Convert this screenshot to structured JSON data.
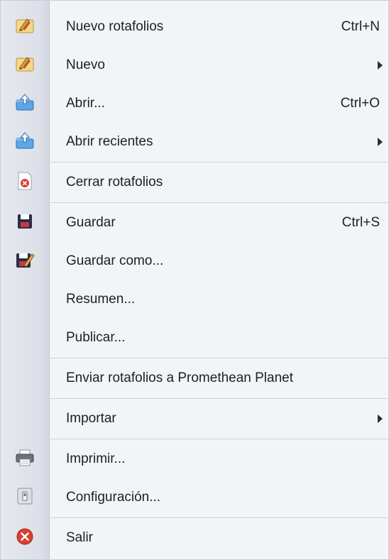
{
  "menu": {
    "items": [
      {
        "label": "Nuevo rotafolios",
        "shortcut": "Ctrl+N",
        "icon": "flipchart-new-icon"
      },
      {
        "label": "Nuevo",
        "submenu": true,
        "icon": "flipchart-new-icon"
      },
      {
        "label": "Abrir...",
        "shortcut": "Ctrl+O",
        "icon": "folder-open-icon"
      },
      {
        "label": "Abrir recientes",
        "submenu": true,
        "icon": "folder-open-icon"
      },
      {
        "label": "Cerrar rotafolios",
        "icon": "close-document-icon"
      },
      {
        "label": "Guardar",
        "shortcut": "Ctrl+S",
        "icon": "save-icon"
      },
      {
        "label": "Guardar como...",
        "icon": "save-as-icon"
      },
      {
        "label": "Resumen...",
        "icon": ""
      },
      {
        "label": "Publicar...",
        "icon": ""
      },
      {
        "label": "Enviar rotafolios a Promethean Planet",
        "icon": ""
      },
      {
        "label": "Importar",
        "submenu": true,
        "icon": ""
      },
      {
        "label": "Imprimir...",
        "icon": "printer-icon"
      },
      {
        "label": "Configuración...",
        "icon": "settings-icon"
      },
      {
        "label": "Salir",
        "icon": "exit-icon"
      }
    ],
    "colors": {
      "exit_red": "#d9402f",
      "folder_blue": "#3f8fd6",
      "save_dark": "#2b2e45"
    }
  }
}
